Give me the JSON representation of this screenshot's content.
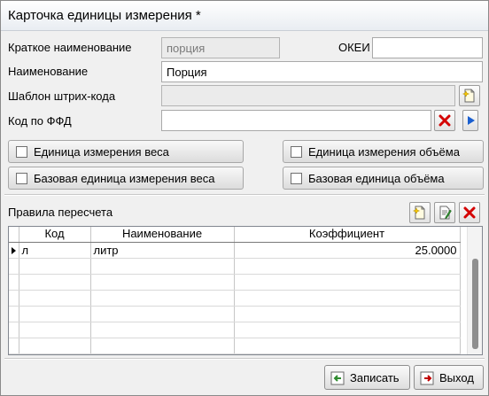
{
  "window": {
    "title": "Карточка единицы измерения *"
  },
  "form": {
    "short_name_label": "Краткое наименование",
    "short_name_value": "порция",
    "okei_label": "ОКЕИ",
    "okei_value": "",
    "name_label": "Наименование",
    "name_value": "Порция",
    "barcode_label": "Шаблон штрих-кода",
    "barcode_value": "",
    "ffd_label": "Код по ФФД",
    "ffd_value": ""
  },
  "checks": {
    "weight_unit": "Единица измерения веса",
    "volume_unit": "Единица измерения объёма",
    "base_weight_unit": "Базовая единица измерения веса",
    "base_volume_unit": "Базовая единица объёма"
  },
  "rules": {
    "title": "Правила пересчета",
    "columns": [
      "Код",
      "Наименование",
      "Коэффициент"
    ],
    "rows": [
      {
        "code": "л",
        "name": "литр",
        "coef": "25.0000"
      }
    ]
  },
  "footer": {
    "save_label": "Записать",
    "exit_label": "Выход"
  },
  "colors": {
    "delete_red": "#d40000",
    "save_green": "#2e8b2e",
    "exit_red": "#c00000",
    "nav_blue": "#1a5fd0"
  },
  "icons": {
    "barcode_add": "new-document-icon",
    "ffd_clear": "red-x-icon",
    "ffd_open": "play-arrow-icon",
    "add_rule": "new-document-icon",
    "edit_rule": "edit-document-icon",
    "delete_rule": "red-x-icon",
    "save": "save-arrow-icon",
    "exit": "exit-door-icon"
  }
}
